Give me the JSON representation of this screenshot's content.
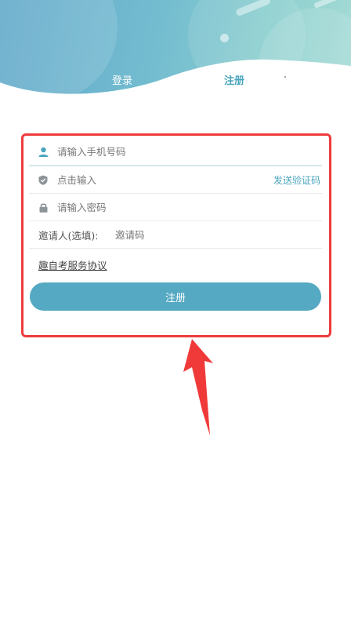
{
  "tabs": {
    "login": "登录",
    "register": "注册"
  },
  "form": {
    "phone_placeholder": "请输入手机号码",
    "code_placeholder": "点击输入",
    "send_code": "发送验证码",
    "password_placeholder": "请输入密码",
    "inviter_label": "邀请人(选填):",
    "inviter_placeholder": "邀请码",
    "agreement": "趣自考服务协议",
    "submit": "注册"
  },
  "colors": {
    "accent": "#55a9c2",
    "tab_active": "#4aa6be",
    "annotation": "#ee3b3b"
  },
  "icons": {
    "phone": "user-icon",
    "code": "shield-check-icon",
    "password": "lock-icon"
  }
}
